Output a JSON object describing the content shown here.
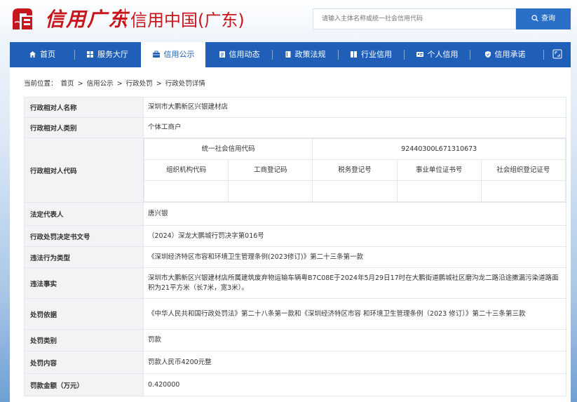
{
  "header": {
    "logo_script": "信用广东",
    "site_title": "信用中国(广东)",
    "search_placeholder": "请输入主体名称或统一社会信用代码",
    "search_button": "查询"
  },
  "nav": {
    "items": [
      {
        "label": "首页",
        "icon": "home-icon"
      },
      {
        "label": "服务大厅",
        "icon": "grid-icon"
      },
      {
        "label": "信用公示",
        "icon": "briefcase-icon"
      },
      {
        "label": "信用动态",
        "icon": "document-icon"
      },
      {
        "label": "政策法规",
        "icon": "book-icon"
      },
      {
        "label": "行业信用",
        "icon": "columns-icon"
      },
      {
        "label": "个人信用",
        "icon": "id-card-icon"
      },
      {
        "label": "信用承诺",
        "icon": "shield-icon"
      }
    ],
    "active": "信用公示",
    "expand_icon": "fullscreen-icon"
  },
  "breadcrumb": {
    "prefix": "当前位置：",
    "items": [
      "首页",
      "信用公示",
      "行政处罚",
      "行政处罚详情"
    ],
    "separator": ">"
  },
  "detail": {
    "rows": [
      {
        "label": "行政相对人名称",
        "value": "深圳市大鹏新区兴银建材店"
      },
      {
        "label": "行政相对人类别",
        "value": "个体工商户"
      },
      {
        "label": "法定代表人",
        "value": "唐兴银"
      },
      {
        "label": "行政处罚决定书文号",
        "value": "（2024）深龙大鹏城行罚决字第016号"
      },
      {
        "label": "违法行为类型",
        "value": "《深圳经济特区市容和环境卫生管理条例(2023修订)》第二十三条第一款"
      },
      {
        "label": "违法事实",
        "value": "深圳市大鹏新区兴银建材店所属建筑废弃物运输车辆粤B7C08E于2024年5月29日17时在大鹏街道鹏城社区磨沟龙二路沿途撒漏污染道路面积为21平方米（长7米，宽3米）。"
      },
      {
        "label": "处罚依据",
        "value": "《中华人民共和国行政处罚法》第二十八条第一款和《深圳经济特区市容 和环境卫生管理条例（2023 修订）》第二十三条第三款"
      },
      {
        "label": "处罚类别",
        "value": "罚款"
      },
      {
        "label": "处罚内容",
        "value": "罚款人民币4200元整"
      },
      {
        "label": "罚款金额（万元）",
        "value": "0.420000"
      }
    ],
    "code": {
      "label": "行政相对人代码",
      "uscc_label": "统一社会信用代码",
      "uscc_value": "92440300L671310673",
      "sub_labels": [
        "组织机构代码",
        "工商登记码",
        "税务登记号",
        "事业单位证书号",
        "社会组织登记证号"
      ],
      "sub_values": [
        "",
        "",
        "",
        "",
        ""
      ]
    }
  }
}
